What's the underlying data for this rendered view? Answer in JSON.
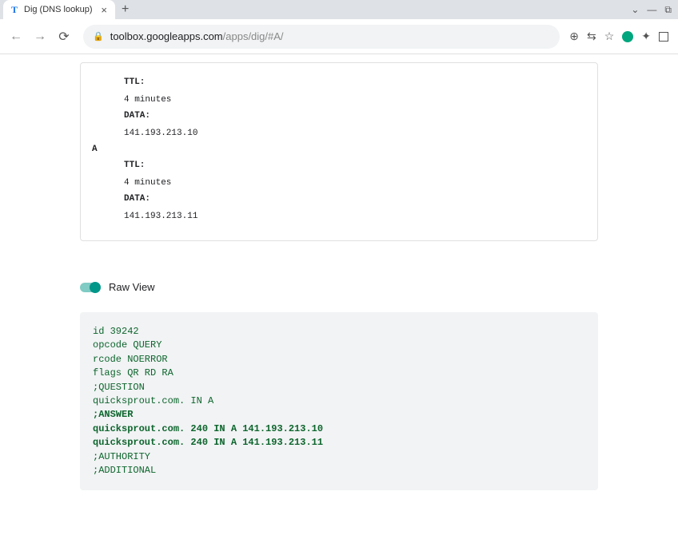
{
  "browser": {
    "tab_title": "Dig (DNS lookup)",
    "tab_close": "×",
    "new_tab": "+",
    "url_host": "toolbox.googleapps.com",
    "url_path": "/apps/dig/#A/",
    "window_min": "—",
    "window_max": "⧉",
    "chevron": "⌄"
  },
  "records": [
    {
      "type": "",
      "ttl_label": "TTL:",
      "ttl_value": "4 minutes",
      "data_label": "DATA:",
      "data_value": "141.193.213.10"
    },
    {
      "type": "A",
      "ttl_label": "TTL:",
      "ttl_value": "4 minutes",
      "data_label": "DATA:",
      "data_value": "141.193.213.11"
    }
  ],
  "raw_view_label": "Raw View",
  "raw_output": {
    "lines": [
      {
        "text": "id 39242",
        "bold": false
      },
      {
        "text": "opcode QUERY",
        "bold": false
      },
      {
        "text": "rcode NOERROR",
        "bold": false
      },
      {
        "text": "flags QR RD RA",
        "bold": false
      },
      {
        "text": ";QUESTION",
        "bold": false
      },
      {
        "text": "quicksprout.com. IN A",
        "bold": false
      },
      {
        "text": ";ANSWER",
        "bold": true
      },
      {
        "text": "quicksprout.com. 240 IN A 141.193.213.10",
        "bold": true
      },
      {
        "text": "quicksprout.com. 240 IN A 141.193.213.11",
        "bold": true
      },
      {
        "text": ";AUTHORITY",
        "bold": false
      },
      {
        "text": ";ADDITIONAL",
        "bold": false
      }
    ]
  }
}
